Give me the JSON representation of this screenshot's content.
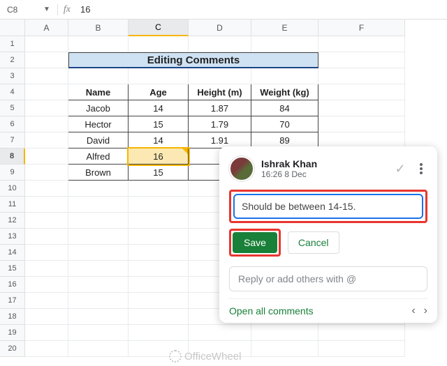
{
  "namebox": "C8",
  "formula": "16",
  "columns": [
    "A",
    "B",
    "C",
    "D",
    "E",
    "F"
  ],
  "rows": [
    "1",
    "2",
    "3",
    "4",
    "5",
    "6",
    "7",
    "8",
    "9",
    "10",
    "11",
    "12",
    "13",
    "14",
    "15",
    "16",
    "17",
    "18",
    "19",
    "20"
  ],
  "title": "Editing Comments",
  "headers": {
    "name": "Name",
    "age": "Age",
    "height": "Height (m)",
    "weight": "Weight (kg)"
  },
  "table": [
    {
      "name": "Jacob",
      "age": "14",
      "height": "1.87",
      "weight": "84"
    },
    {
      "name": "Hector",
      "age": "15",
      "height": "1.79",
      "weight": "70"
    },
    {
      "name": "David",
      "age": "14",
      "height": "1.91",
      "weight": "89"
    },
    {
      "name": "Alfred",
      "age": "16",
      "height": "",
      "weight": ""
    },
    {
      "name": "Brown",
      "age": "15",
      "height": "",
      "weight": ""
    }
  ],
  "comment": {
    "user": "Ishrak Khan",
    "time": "16:26 8 Dec",
    "text": "Should be between 14-15.",
    "save": "Save",
    "cancel": "Cancel",
    "reply_ph": "Reply or add others with @",
    "open_all": "Open all comments"
  },
  "watermark": "OfficeWheel"
}
